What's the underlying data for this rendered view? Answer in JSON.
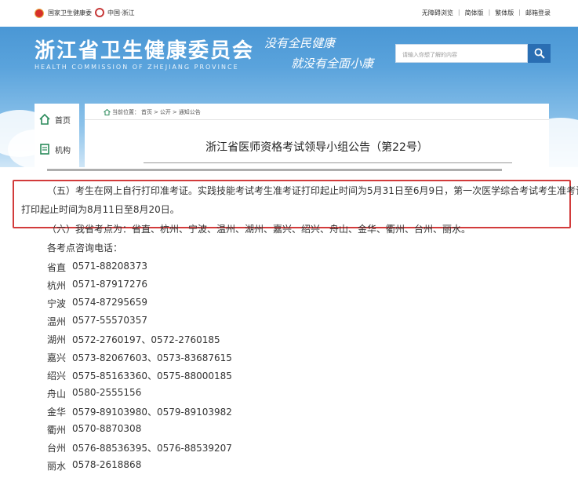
{
  "topbar": {
    "org_name": "国家卫生健康委",
    "zj_name": "中国·浙江",
    "links": [
      "无障碍浏览",
      "简体版",
      "繁体版",
      "邮箱登录"
    ]
  },
  "header": {
    "title": "浙江省卫生健康委员会",
    "subtitle": "HEALTH COMMISSION OF ZHEJIANG PROVINCE",
    "slogan_line1": "没有全民健康",
    "slogan_line2": "就没有全面小康"
  },
  "search": {
    "placeholder": "请输入你想了解的内容"
  },
  "sidebar": {
    "items": [
      {
        "label": "首页"
      },
      {
        "label": "机构"
      }
    ]
  },
  "breadcrumb": {
    "prefix": "当前位置：",
    "items": [
      "首页",
      "公开",
      "通知公告"
    ]
  },
  "article": {
    "title": "浙江省医师资格考试领导小组公告（第22号）",
    "item5_line1": "（五）考生在网上自行打印准考证。实践技能考试考生准考证打印起止时间为5月31日至6月9日，第一次医学综合考试考生准考证",
    "item5_line2": "打印起止时间为8月11日至8月20日。",
    "item6": "（六）我省考点为：省直、杭州、宁波、温州、湖州、嘉兴、绍兴、舟山、金华、衢州、台州、丽水。",
    "phones_heading": "各考点咨询电话：",
    "phones": [
      {
        "site": "省直",
        "number": "0571-88208373"
      },
      {
        "site": "杭州",
        "number": "0571-87917276"
      },
      {
        "site": "宁波",
        "number": "0574-87295659"
      },
      {
        "site": "温州",
        "number": "0577-55570357"
      },
      {
        "site": "湖州",
        "number": "0572-2760197、0572-2760185"
      },
      {
        "site": "嘉兴",
        "number": "0573-82067603、0573-83687615"
      },
      {
        "site": "绍兴",
        "number": "0575-85163360、0575-88000185"
      },
      {
        "site": "舟山",
        "number": "0580-2555156"
      },
      {
        "site": "金华",
        "number": "0579-89103980、0579-89103982"
      },
      {
        "site": "衢州",
        "number": "0570-8870308"
      },
      {
        "site": "台州",
        "number": "0576-88536395、0576-88539207"
      },
      {
        "site": "丽水",
        "number": "0578-2618868"
      }
    ]
  },
  "colors": {
    "header_blue": "#3f8fd0",
    "search_button": "#2a6eb3",
    "highlight_border": "#d23b3b"
  }
}
